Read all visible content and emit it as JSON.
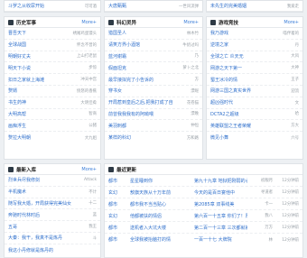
{
  "top_strip": [
    {
      "name": "斗罗之从收尿开始",
      "meta": "可可酒"
    },
    {
      "name": "大唐甄甄",
      "meta": "一世风流弹"
    },
    {
      "name": "未先生的完美婚姻",
      "meta": "我爱走"
    }
  ],
  "more_label": "More+",
  "panels": [
    {
      "title": "历史军事",
      "items": [
        {
          "name": "晋吾天下",
          "meta": "绣尾鸡蛋馒头"
        },
        {
          "name": "全球战国",
          "meta": "怀念不曾的"
        },
        {
          "name": "明朝好丈夫",
          "meta": "上山打老鼠"
        },
        {
          "name": "明天下小说",
          "meta": "步惊"
        },
        {
          "name": "扣日之家就上海滩",
          "meta": "冲天中宫"
        },
        {
          "name": "赘婿",
          "meta": "愤怒的香蕉"
        },
        {
          "name": "书生药神",
          "meta": "大明佳肴"
        },
        {
          "name": "大明高帮",
          "meta": "智商"
        },
        {
          "name": "画痴浮生",
          "meta": "公猪"
        },
        {
          "name": "赘拉大明朝",
          "meta": "大九姐"
        }
      ]
    },
    {
      "title": "科幻灵异",
      "items": [
        {
          "name": "猎国圣人",
          "meta": "林木竹"
        },
        {
          "name": "请笑方界小酒馆",
          "meta": "牛奶过吗"
        },
        {
          "name": "蓝河谢霜",
          "meta": "乃"
        },
        {
          "name": "假面坦克",
          "meta": "萝卜之北"
        },
        {
          "name": "最早接拟完了小告诉的",
          "meta": "方"
        },
        {
          "name": "穿书女",
          "meta": "漂呢"
        },
        {
          "name": "开局惹到皇后之后,把我打成了自",
          "meta": "花卷猫"
        },
        {
          "name": "前曾我我我有的阿呦喂",
          "meta": "漂晚"
        },
        {
          "name": "美羽刺都",
          "meta": "仲恒"
        },
        {
          "name": "某样的科幻",
          "meta": "方和路"
        }
      ]
    },
    {
      "title": "游戏竞技",
      "items": [
        {
          "name": "我乃游戏",
          "meta": "喵伴着的"
        },
        {
          "name": "逆境之家",
          "meta": "丹"
        },
        {
          "name": "全球之亡 炎天无",
          "meta": "大风"
        },
        {
          "name": "网游之天下第一",
          "meta": "大神"
        },
        {
          "name": "蜀王冰冷的情",
          "meta": "王子"
        },
        {
          "name": "网游三国之真实世界",
          "meta": "迎流"
        },
        {
          "name": "超凶强时代",
          "meta": "文"
        },
        {
          "name": "DCTA2之超级",
          "meta": "哈"
        },
        {
          "name": "英雄联盟之王者荣耀",
          "meta": "方大"
        },
        {
          "name": "微见小舞",
          "meta": "六号"
        }
      ]
    }
  ],
  "latest_panel": {
    "title": "最新入库",
    "items": [
      {
        "name": "烈世兵尽我修剑",
        "meta": "Attack"
      },
      {
        "name": "半机魔术",
        "meta": "不计"
      },
      {
        "name": "随写我大婚，开局获得完美仙女",
        "meta": "十二"
      },
      {
        "name": "奔驰时代林时后",
        "meta": "蓝"
      },
      {
        "name": "五哥",
        "meta": "我王"
      },
      {
        "name": "大秦：我干，我真不是炼丹",
        "meta": "斗"
      },
      {
        "name": "我这小丹修就是炼丹的",
        "meta": ""
      }
    ]
  },
  "updates_panel": {
    "title": "最近更新",
    "items": [
      {
        "cat": "都市",
        "novel": "星星睡到你",
        "chapter": "第九十九章 地狱把刚弱的心",
        "author": "初靓月",
        "time": "12分钟前"
      },
      {
        "cat": "玄幻",
        "novel": "敖旗天族从十万年前",
        "chapter": "今天的是百日宴他中",
        "author": "寻道者",
        "time": "12分钟前"
      },
      {
        "cat": "都市",
        "novel": "都市我不当当贴心",
        "chapter": "第2085章 双事线美",
        "author": "卡一",
        "time": "12分钟前"
      },
      {
        "cat": "玄幻",
        "novel": "他都被扶的情侣",
        "chapter": "第六百一十五章 你们了！厚面色读了",
        "author": "我八",
        "time": "12分钟前"
      },
      {
        "cat": "都市",
        "novel": "送机者入大坑大楼",
        "chapter": "第二百一十三章 三次都就被的！为乡你可人",
        "author": "万方",
        "time": "12分钟前"
      },
      {
        "cat": "都市",
        "novel": "全球我被抬脑打的情",
        "chapter": "一百一十七 大牌院",
        "author": "林",
        "time": "12分钟前"
      }
    ]
  }
}
